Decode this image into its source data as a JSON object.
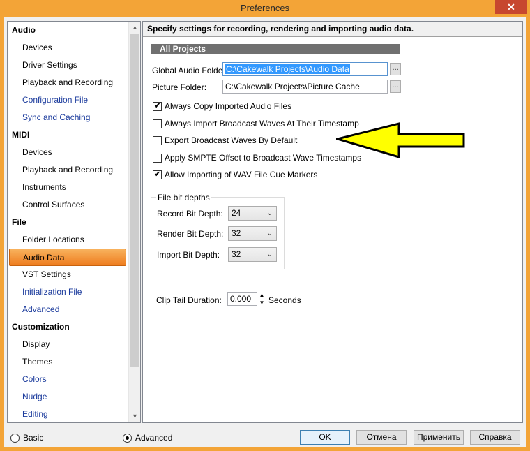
{
  "window": {
    "title": "Preferences",
    "close_label": "✕"
  },
  "tree": {
    "items": [
      {
        "label": "Audio",
        "kind": "cat"
      },
      {
        "label": "Devices",
        "kind": "sub"
      },
      {
        "label": "Driver Settings",
        "kind": "sub"
      },
      {
        "label": "Playback and Recording",
        "kind": "sub"
      },
      {
        "label": "Configuration File",
        "kind": "link"
      },
      {
        "label": "Sync and Caching",
        "kind": "link"
      },
      {
        "label": "MIDI",
        "kind": "cat"
      },
      {
        "label": "Devices",
        "kind": "sub"
      },
      {
        "label": "Playback and Recording",
        "kind": "sub"
      },
      {
        "label": "Instruments",
        "kind": "sub"
      },
      {
        "label": "Control Surfaces",
        "kind": "sub"
      },
      {
        "label": "File",
        "kind": "cat"
      },
      {
        "label": "Folder Locations",
        "kind": "sub"
      },
      {
        "label": "Audio Data",
        "kind": "selected"
      },
      {
        "label": "VST Settings",
        "kind": "sub"
      },
      {
        "label": "Initialization File",
        "kind": "link"
      },
      {
        "label": "Advanced",
        "kind": "link"
      },
      {
        "label": "Customization",
        "kind": "cat"
      },
      {
        "label": "Display",
        "kind": "sub"
      },
      {
        "label": "Themes",
        "kind": "sub"
      },
      {
        "label": "Colors",
        "kind": "link"
      },
      {
        "label": "Nudge",
        "kind": "link"
      },
      {
        "label": "Editing",
        "kind": "link"
      }
    ],
    "scroll_up": "▲",
    "scroll_down": "▼"
  },
  "panel": {
    "description": "Specify settings for recording, rendering and importing audio data.",
    "section_title": "All Projects",
    "global_audio_folder_label": "Global Audio Folder:",
    "global_audio_folder_value": "C:\\Cakewalk Projects\\Audio Data",
    "picture_folder_label": "Picture Folder:",
    "picture_folder_value": "C:\\Cakewalk Projects\\Picture Cache",
    "browse_label": "...",
    "checkboxes": [
      {
        "label": "Always Copy Imported Audio Files",
        "checked": true
      },
      {
        "label": "Always Import Broadcast Waves At Their Timestamp",
        "checked": false
      },
      {
        "label": "Export Broadcast Waves By Default",
        "checked": false
      },
      {
        "label": "Apply SMPTE Offset to Broadcast Wave Timestamps",
        "checked": false
      },
      {
        "label": "Allow Importing of WAV File Cue Markers",
        "checked": true
      }
    ],
    "bit_depths": {
      "group_title": "File bit depths",
      "record_label": "Record Bit Depth:",
      "record_value": "24",
      "render_label": "Render Bit Depth:",
      "render_value": "32",
      "import_label": "Import Bit Depth:",
      "import_value": "32"
    },
    "clip_tail_label": "Clip Tail Duration:",
    "clip_tail_value": "0.000",
    "clip_tail_unit": "Seconds",
    "annotation_arrow_color": "#ffff00"
  },
  "footer": {
    "mode_basic": "Basic",
    "mode_advanced": "Advanced",
    "mode_selected": "Advanced",
    "ok": "OK",
    "cancel": "Отмена",
    "apply": "Применить",
    "help": "Справка"
  }
}
